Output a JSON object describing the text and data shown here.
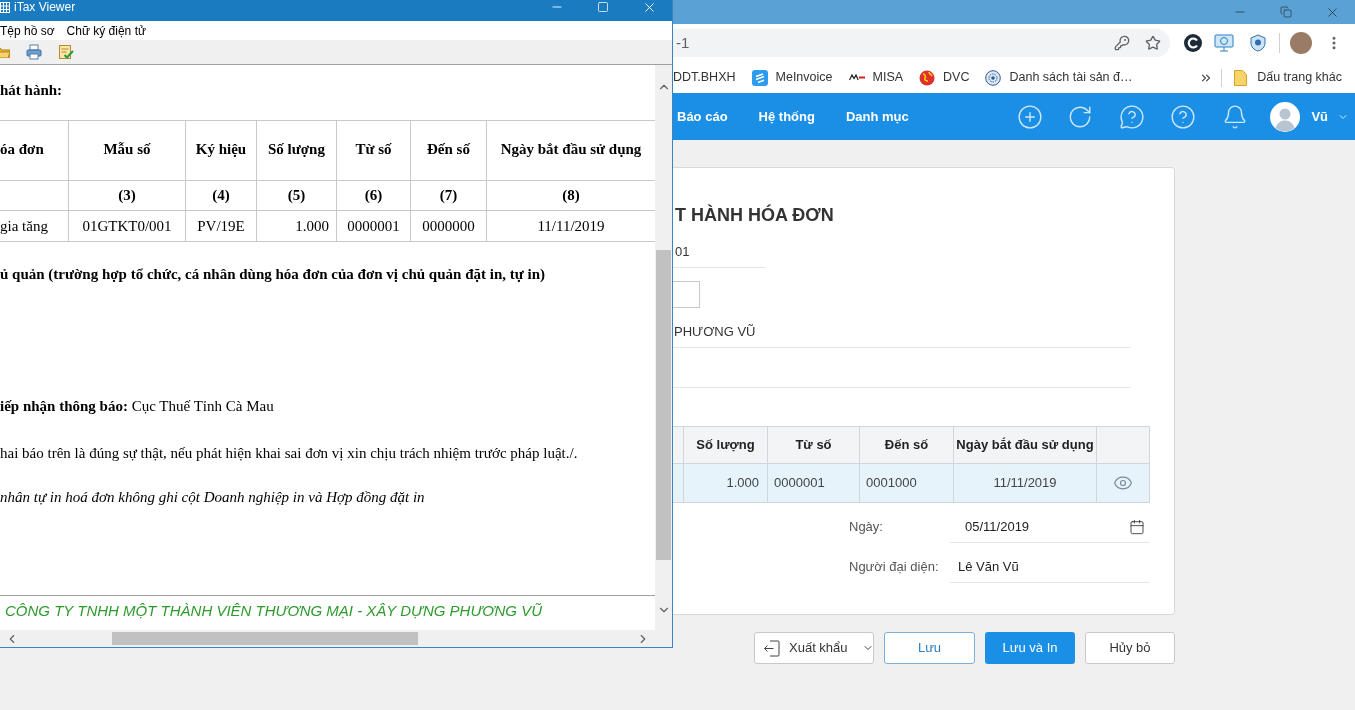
{
  "viewer": {
    "title": "iTax Viewer",
    "menu": [
      {
        "label": "Tệp hồ sơ"
      },
      {
        "label": "Chữ ký điện tử"
      }
    ],
    "heading": "hát hành:",
    "table": {
      "columns": [
        "óa đơn",
        "Mẫu số",
        "Ký hiệu",
        "Số lượng",
        "Từ số",
        "Đến số",
        "Ngày bắt đầu sử dụng"
      ],
      "index_row": [
        "(3)",
        "(4)",
        "(5)",
        "(6)",
        "(7)",
        "(8)"
      ],
      "rows": [
        [
          "gia tăng",
          "01GTKT0/001",
          "PV/19E",
          "1.000",
          "0000001",
          "0000000",
          "11/11/2019"
        ]
      ]
    },
    "paragraphs": [
      {
        "kind": "bold",
        "text": "ủ quản (trường hợp tổ chức, cá nhân dùng hóa đơn của đơn vị chủ quản đặt in, tự in)"
      },
      {
        "kind": "plain",
        "text": "**iếp nhận thông báo:** Cục Thuế Tỉnh Cà Mau"
      },
      {
        "kind": "plain",
        "text": "hai báo trên là đúng sự thật, nếu phát hiện khai sai đơn vị xin chịu trách nhiệm trước pháp luật./."
      },
      {
        "kind": "italic",
        "text": "nhân tự in hoá đơn không ghi cột Doanh nghiệp in và Hợp đồng đặt in"
      }
    ],
    "footer": "CÔNG TY TNHH MỘT THÀNH VIÊN THƯƠNG MẠI - XÂY DỰNG PHƯƠNG VŨ"
  },
  "browser": {
    "address": "-1",
    "bookmarks": [
      {
        "label": "DDT.BHXH",
        "kind": "plain"
      },
      {
        "label": "MeInvoice",
        "kind": "tile"
      },
      {
        "label": "MISA",
        "kind": "logo"
      },
      {
        "label": "DVC",
        "kind": "globe"
      },
      {
        "label": "Danh sách tài sản đ…",
        "kind": "seal"
      }
    ],
    "other_bookmarks": "Dấu trang khác"
  },
  "app": {
    "nav": [
      {
        "label": "Báo cáo"
      },
      {
        "label": "Hệ thống"
      },
      {
        "label": "Danh mục"
      }
    ],
    "user": "Vũ",
    "form": {
      "title": "T HÀNH HÓA ĐƠN",
      "fields": [
        {
          "kind": "short",
          "value": "01"
        },
        {
          "kind": "box"
        },
        {
          "kind": "line",
          "value": "PHƯƠNG VŨ"
        },
        {
          "kind": "line"
        }
      ],
      "table": {
        "columns": [
          "Số lượng",
          "Từ số",
          "Đến số",
          "Ngày bắt đầu sử dụng"
        ],
        "rows": [
          {
            "selected": true,
            "cells": [
              "1.000",
              "0000001",
              "0001000",
              "11/11/2019"
            ]
          }
        ]
      },
      "date": {
        "label": "Ngày:",
        "value": "05/11/2019"
      },
      "representative": {
        "label": "Người đại diện:",
        "value": "Lê Văn Vũ"
      }
    },
    "buttons": [
      {
        "label": "Xuất khẩu",
        "kind": "dropdown"
      },
      {
        "label": "Lưu",
        "kind": "outline"
      },
      {
        "label": "Lưu và In",
        "kind": "primary"
      },
      {
        "label": "Hủy bỏ",
        "kind": "default"
      }
    ]
  }
}
